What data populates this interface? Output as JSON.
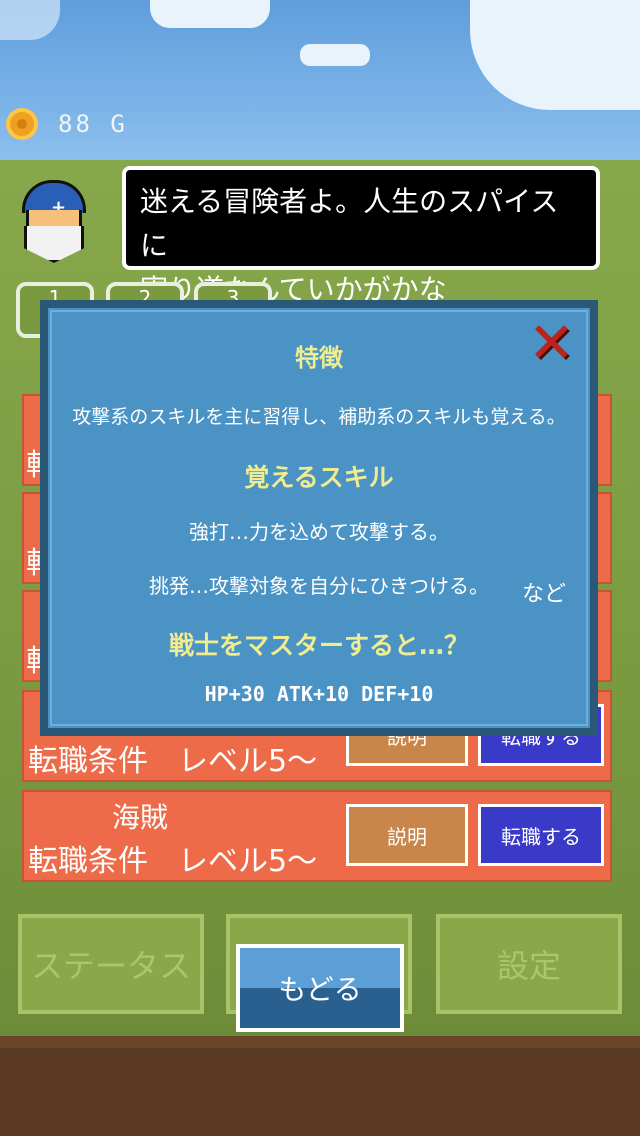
{
  "gold": {
    "icon": "coin-icon",
    "amount": "88 G"
  },
  "dialog": {
    "line1": "迷える冒険者よ。人生のスパイスに",
    "line2": "寄り道なんていかがかな"
  },
  "tabs": [
    "1",
    "2",
    "3"
  ],
  "jobs": [
    {
      "edge": "転",
      "partial": true
    },
    {
      "edge": "転",
      "partial": true
    },
    {
      "edge": "転",
      "partial": true
    },
    {
      "name": "",
      "condition": "転職条件　レベル5～",
      "desc_label": "説明",
      "change_label": "転職する"
    },
    {
      "name": "海賊",
      "condition": "転職条件　レベル5～",
      "desc_label": "説明",
      "change_label": "転職する"
    }
  ],
  "bottom": {
    "status_label": "ステータス",
    "settings_label": "設定",
    "back_label": "もどる"
  },
  "popup": {
    "feature_heading": "特徴",
    "feature_text": "攻撃系のスキルを主に習得し、補助系のスキルも覚える。",
    "skills_heading": "覚えるスキル",
    "skill1": "強打…力を込めて攻撃する。",
    "skill2": "挑発…攻撃対象を自分にひきつける。",
    "etc": "など",
    "master_heading": "戦士をマスターすると…？",
    "master_bonus": "HP+30 ATK+10 DEF+10"
  },
  "colors": {
    "job_row": "#ee6b4a",
    "change_button": "#3a3ac8",
    "desc_button": "#c8864a",
    "popup_bg": "#4a93c4"
  }
}
